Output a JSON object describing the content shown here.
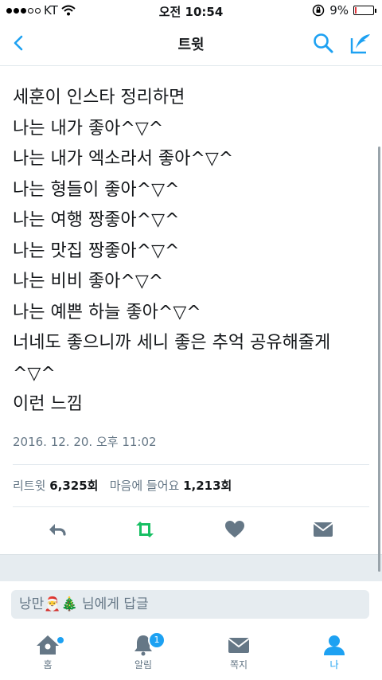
{
  "status_bar": {
    "carrier": "KT",
    "time": "오전 10:54",
    "battery_text": "9%",
    "battery_level": 0.09
  },
  "nav": {
    "title": "트윗"
  },
  "tweet": {
    "lines": [
      "세훈이 인스타 정리하면",
      "나는 내가 좋아^▽^",
      "나는 내가 엑소라서 좋아^▽^",
      "나는 형들이 좋아^▽^",
      "나는 여행 짱좋아^▽^",
      "나는 맛집 짱좋아^▽^",
      "나는 비비 좋아^▽^",
      "나는 예쁜 하늘 좋아^▽^",
      "너네도 좋으니까 세니 좋은 추억 공유해줄게",
      "^▽^",
      "이런 느낌"
    ],
    "timestamp": "2016. 12. 20. 오후 11:02",
    "retweet_label": "리트윗",
    "retweet_count": "6,325회",
    "like_label": "마음에 들어요",
    "like_count": "1,213회"
  },
  "reply": {
    "placeholder": "낭만🎅🎄 님에게 답글"
  },
  "tabs": [
    {
      "label": "홈",
      "icon": "home-icon"
    },
    {
      "label": "알림",
      "icon": "bell-icon",
      "badge": "1"
    },
    {
      "label": "쪽지",
      "icon": "envelope-icon"
    },
    {
      "label": "나",
      "icon": "person-icon"
    }
  ],
  "colors": {
    "accent": "#1da1f2",
    "retweet_active": "#17bf63",
    "icon_gray": "#657786"
  }
}
